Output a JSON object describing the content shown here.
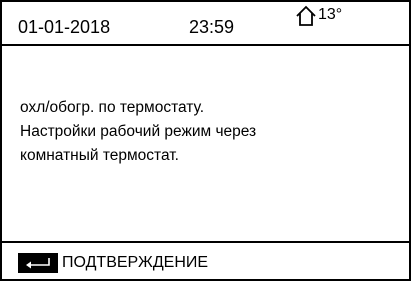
{
  "header": {
    "date": "01-01-2018",
    "time": "23:59",
    "outdoor_icon": "house-outline-icon",
    "outdoor_temperature": "13°"
  },
  "message": {
    "lines": [
      "охл/обогр. по термостату.",
      "Настройки рабочий режим через",
      "комнатный термостат."
    ]
  },
  "footer": {
    "confirm_icon": "enter-key-icon",
    "confirm_label": "ПОДТВЕРЖДЕНИЕ"
  }
}
